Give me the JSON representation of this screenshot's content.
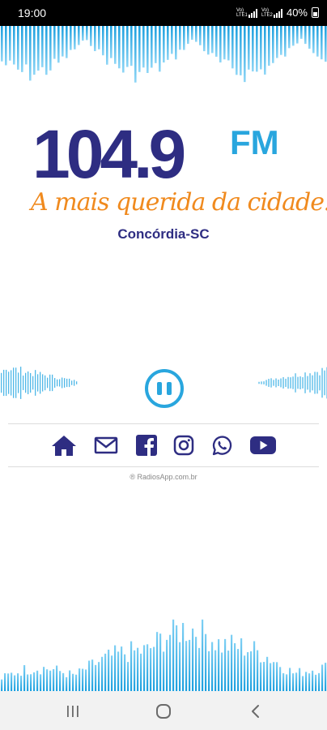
{
  "status_bar": {
    "time": "19:00",
    "network_1": "Vo) LTE1",
    "network_2": "Vo) LTE2",
    "battery": "40%"
  },
  "logo": {
    "number": "104.9",
    "suffix": "FM",
    "slogan": "A mais querida da cidade!",
    "city": "Concórdia-SC"
  },
  "player": {
    "state_icon": "pause-icon"
  },
  "social_links": [
    {
      "id": "home",
      "icon": "home-icon"
    },
    {
      "id": "email",
      "icon": "email-icon"
    },
    {
      "id": "facebook",
      "icon": "facebook-icon"
    },
    {
      "id": "instagram",
      "icon": "instagram-icon"
    },
    {
      "id": "whatsapp",
      "icon": "whatsapp-icon"
    },
    {
      "id": "youtube",
      "icon": "youtube-icon"
    }
  ],
  "credit": "® RadiosApp.com.br",
  "nav_bar": {
    "buttons": [
      "recent-apps",
      "home",
      "back"
    ]
  },
  "colors": {
    "brand_navy": "#2e2d82",
    "brand_blue": "#29a6de",
    "slogan_orange": "#f08a1e"
  }
}
